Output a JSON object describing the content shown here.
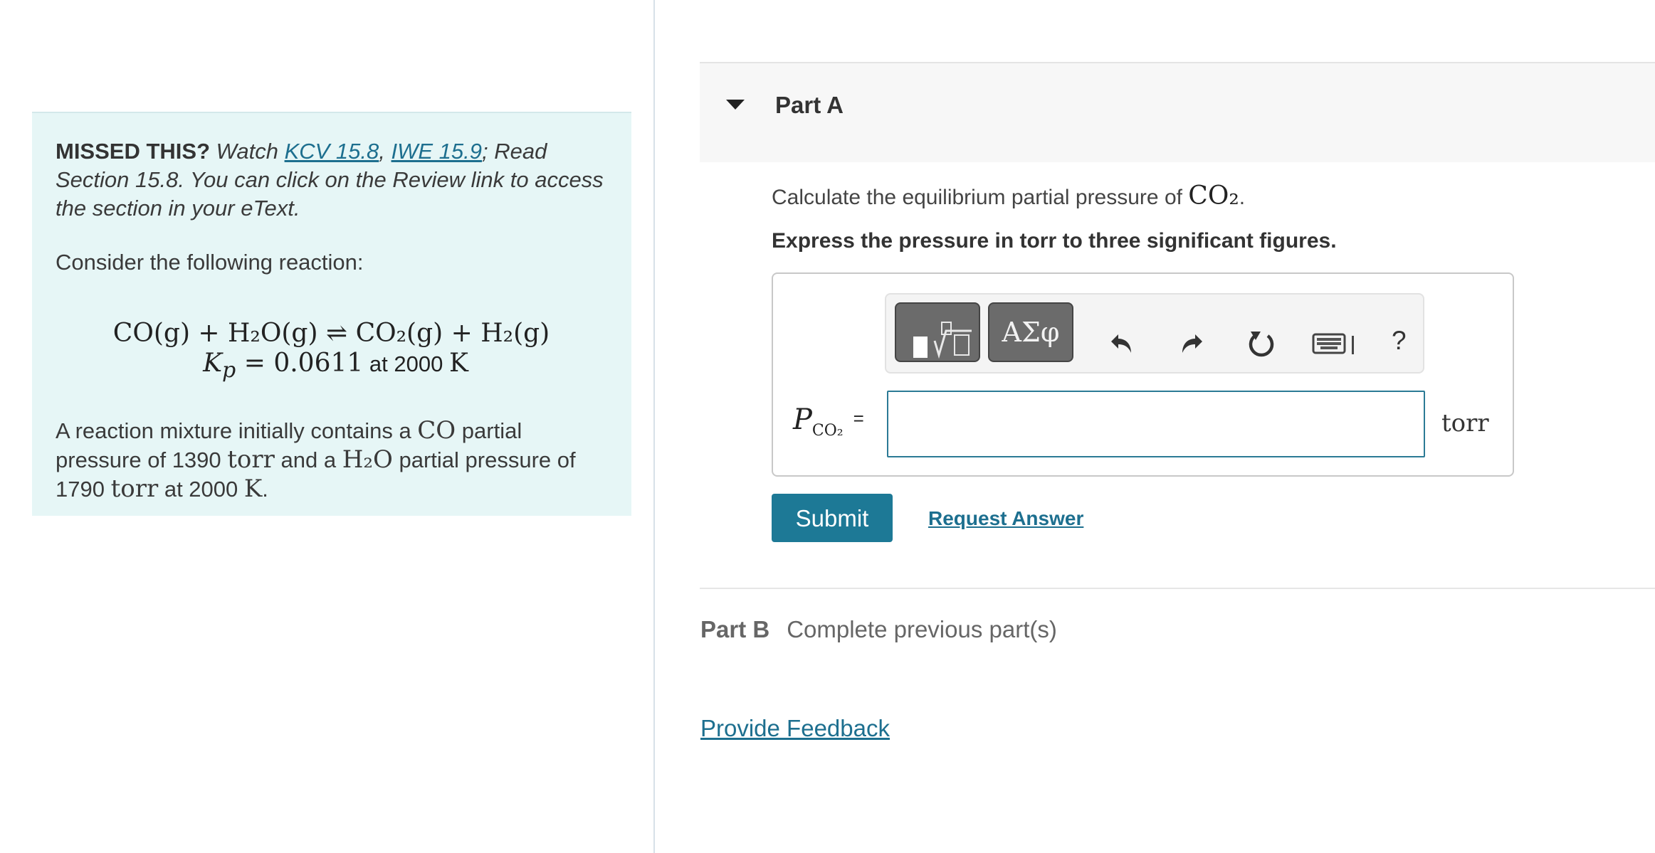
{
  "intro": {
    "missed_label": "MISSED THIS?",
    "watch_text": "Watch",
    "link_kcv": "KCV 15.8",
    "comma": ",",
    "link_iwe": "IWE 15.9",
    "read_text": "; Read Section 15.8. You can click on the Review link to access the section in your eText.",
    "consider_text": "Consider the following reaction:",
    "equation_line1": "CO(g) + H₂O(g) ⇌ CO₂(g) + H₂(g)",
    "kp_symbol": "K",
    "kp_sub": "p",
    "kp_value": " = 0.0611",
    "kp_at": " at 2000 ",
    "kp_temp_unit": "K",
    "mixture_text_1": "A reaction mixture initially contains a ",
    "mixture_co": "CO",
    "mixture_text_2": " partial pressure of 1390 ",
    "mixture_torr1": "torr",
    "mixture_text_3": " and a ",
    "mixture_h2o": "H₂O",
    "mixture_text_4": " partial pressure of 1790 ",
    "mixture_torr2": "torr",
    "mixture_text_5": " at 2000 ",
    "mixture_k": "K",
    "mixture_text_6": "."
  },
  "partA": {
    "title": "Part A",
    "question_text": "Calculate the equilibrium partial pressure of ",
    "question_math": "CO₂",
    "question_end": ".",
    "instruction": "Express the pressure in torr to three significant figures.",
    "toolbar": {
      "symbols_label": "ΑΣφ",
      "help_label": "?"
    },
    "variable": {
      "symbol": "P",
      "subscript": "CO₂",
      "equals": "="
    },
    "answer": {
      "value": "",
      "placeholder": ""
    },
    "unit": "torr",
    "submit_label": "Submit",
    "request_answer_label": "Request Answer"
  },
  "partB": {
    "title": "Part B",
    "status": "Complete previous part(s)"
  },
  "feedback_label": "Provide Feedback",
  "colors": {
    "accent": "#1d7996",
    "intro_bg": "#e6f6f6",
    "link": "#1d6f8f"
  }
}
